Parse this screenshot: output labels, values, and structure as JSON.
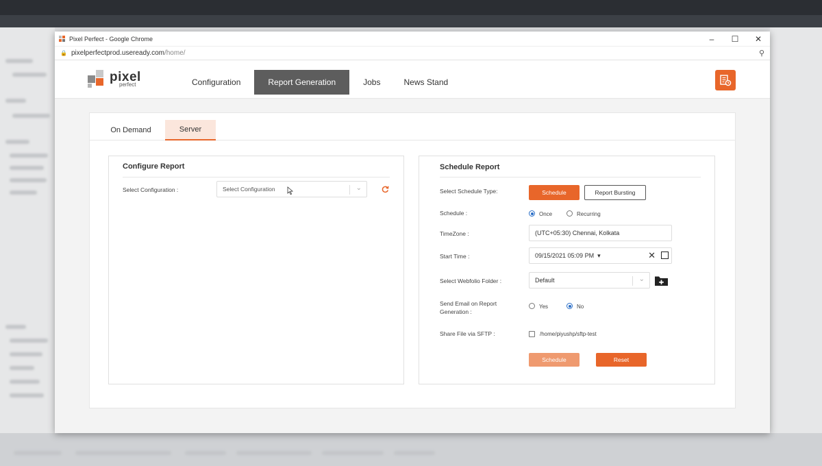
{
  "browser": {
    "window_title": "Pixel Perfect - Google Chrome",
    "url_host": "pixelperfectprod.useready.com",
    "url_path": "/home/"
  },
  "app": {
    "logo": {
      "name": "pixel",
      "sub": "perfect"
    },
    "nav": [
      {
        "label": "Configuration"
      },
      {
        "label": "Report Generation",
        "active": true
      },
      {
        "label": "Jobs"
      },
      {
        "label": "News Stand"
      }
    ],
    "accent_color": "#e8662a"
  },
  "tabs": [
    {
      "label": "On Demand"
    },
    {
      "label": "Server",
      "active": true
    }
  ],
  "configure": {
    "title": "Configure Report",
    "select_label": "Select Configuration :",
    "select_placeholder": "Select Configuration"
  },
  "schedule": {
    "title": "Schedule Report",
    "type_label": "Select Schedule Type:",
    "type_schedule": "Schedule",
    "type_bursting": "Report Bursting",
    "schedule_label": "Schedule :",
    "once": "Once",
    "recurring": "Recurring",
    "timezone_label": "TimeZone :",
    "timezone_value": "(UTC+05:30) Chennai, Kolkata",
    "start_label": "Start Time :",
    "start_value": "09/15/2021 05:09  PM",
    "folder_label": "Select Webfolio Folder :",
    "folder_value": "Default",
    "email_label_1": "Send Email on Report",
    "email_label_2": "Generation :",
    "yes": "Yes",
    "no": "No",
    "sftp_label": "Share File via SFTP :",
    "sftp_path": "/home/piyushp/sftp-test",
    "submit": "Schedule",
    "reset": "Reset"
  }
}
